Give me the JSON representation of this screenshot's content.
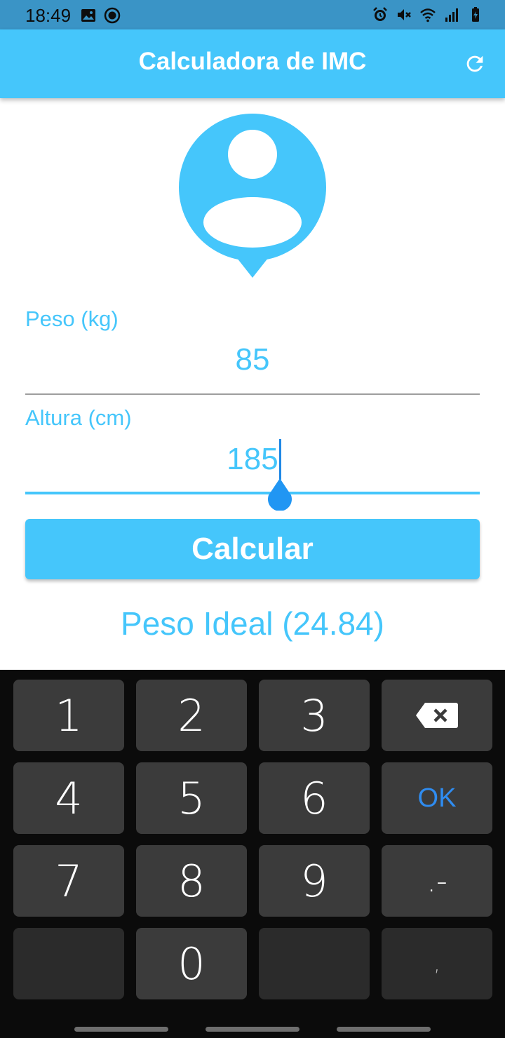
{
  "status_bar": {
    "time": "18:49",
    "left_icons": [
      "image-icon",
      "record-icon"
    ],
    "right_icons": [
      "alarm-icon",
      "mute-icon",
      "wifi-icon",
      "signal-icon",
      "battery-icon"
    ]
  },
  "app_bar": {
    "title": "Calculadora de IMC",
    "action_icon": "refresh-icon"
  },
  "avatar_icon": "person-pin-icon",
  "peso": {
    "label": "Peso (kg)",
    "value": "85"
  },
  "altura": {
    "label": "Altura (cm)",
    "value": "185"
  },
  "calc_button": {
    "label": "Calcular"
  },
  "result": {
    "text": "Peso Ideal (24.84)"
  },
  "keyboard": {
    "keys": [
      "1",
      "2",
      "3",
      "backspace",
      "4",
      "5",
      "6",
      "OK",
      "7",
      "8",
      "9",
      ".-",
      "",
      "0",
      "",
      ","
    ]
  },
  "colors": {
    "accent": "#45c6fb",
    "status_bar": "#3a94c6",
    "keyboard_bg": "#0b0b0b",
    "key_bg": "#3b3b3b",
    "ok_blue": "#2f8cf0",
    "cursor_handle": "#2196f3"
  }
}
